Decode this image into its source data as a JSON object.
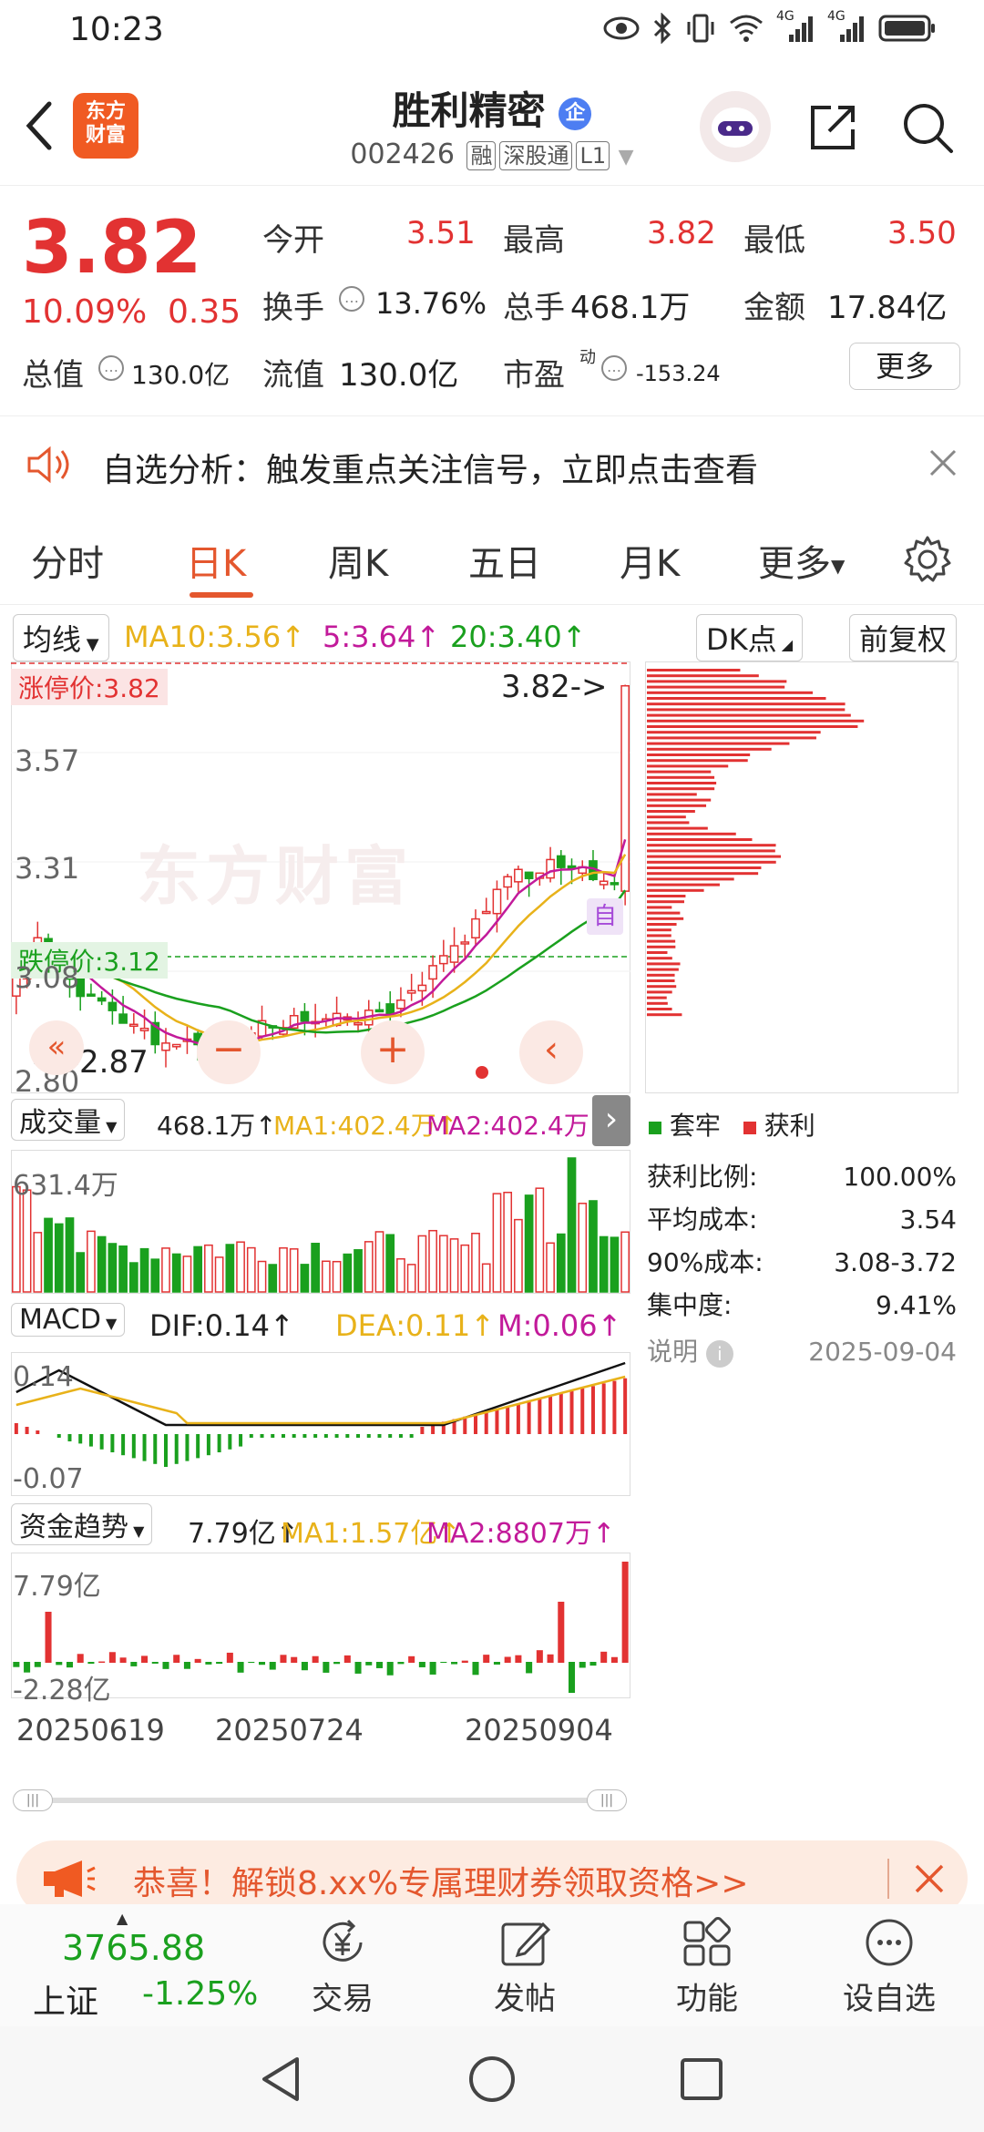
{
  "status": {
    "time": "10:23",
    "net1": "4G",
    "net2": "4G"
  },
  "header": {
    "logo_line1": "东方",
    "logo_line2": "财富",
    "stock_name": "胜利精密",
    "badge": "企",
    "code": "002426",
    "tags": [
      "融",
      "深股通",
      "L1"
    ]
  },
  "quote": {
    "price": "3.82",
    "change_pct": "10.09%",
    "change_amt": "0.35",
    "open_label": "今开",
    "open": "3.51",
    "high_label": "最高",
    "high": "3.82",
    "low_label": "最低",
    "low": "3.50",
    "turnover_label": "换手",
    "turnover": "13.76%",
    "volume_label": "总手",
    "volume": "468.1万",
    "amount_label": "金额",
    "amount": "17.84亿",
    "mktcap_label": "总值",
    "mktcap": "130.0亿",
    "float_label": "流值",
    "float": "130.0亿",
    "pe_label": "市盈",
    "pe_sup": "动",
    "pe": "-153.24",
    "more": "更多"
  },
  "notice": {
    "text": "自选分析：触发重点关注信号，立即点击查看"
  },
  "tabs": [
    {
      "label": "分时",
      "active": false
    },
    {
      "label": "日K",
      "active": true
    },
    {
      "label": "周K",
      "active": false
    },
    {
      "label": "五日",
      "active": false
    },
    {
      "label": "月K",
      "active": false
    },
    {
      "label": "更多",
      "active": false
    }
  ],
  "kline": {
    "indicator": "均线",
    "ma10": "MA10:3.56↑",
    "ma5": "5:3.64↑",
    "ma20": "20:3.40↑",
    "dk_button": "DK点",
    "adjust_button": "前复权",
    "limit_up": "涨停价:3.82",
    "limit_down": "跌停价:3.12",
    "y_3_57": "3.57",
    "y_3_31": "3.31",
    "y_3_08": "3.08",
    "y_2_80": "2.80",
    "current": "3.82->",
    "low_mark": "<--2.87",
    "self_mark": "自",
    "watermark": "东方财富"
  },
  "chips": {
    "legend_trapped": "套牢",
    "legend_profit": "获利",
    "rows": [
      {
        "label": "获利比例:",
        "value": "100.00%"
      },
      {
        "label": "平均成本:",
        "value": "3.54"
      },
      {
        "label": "90%成本:",
        "value": "3.08-3.72"
      },
      {
        "label": "集中度:",
        "value": "9.41%"
      }
    ],
    "note": "说明",
    "date": "2025-09-04"
  },
  "volume": {
    "title": "成交量",
    "value": "468.1万↑",
    "ma1": "MA1:402.4万↑",
    "ma2": "MA2:402.4万↑",
    "ymax": "631.4万"
  },
  "macd": {
    "title": "MACD",
    "dif": "DIF:0.14↑",
    "dea": "DEA:0.11↑",
    "m": "M:0.06↑",
    "ytop": "0.14",
    "ybot": "-0.07"
  },
  "fund": {
    "title": "资金趋势",
    "value": "7.79亿↑",
    "ma1": "MA1:1.57亿↑",
    "ma2": "MA2:8807万↑",
    "ytop": "7.79亿",
    "ybot": "-2.28亿"
  },
  "dates": [
    "20250619",
    "20250724",
    "20250904"
  ],
  "promo": {
    "text": "恭喜！解锁8.xx%专属理财券领取资格>>"
  },
  "bottom": {
    "index_value": "3765.88",
    "index_name": "上证",
    "index_change": "-1.25%",
    "nav": [
      {
        "label": "交易"
      },
      {
        "label": "发帖"
      },
      {
        "label": "功能"
      },
      {
        "label": "设自选"
      }
    ]
  },
  "colors": {
    "red": "#e23232",
    "green": "#1aa01e",
    "orange": "#e4572e",
    "ma10": "#e8b21a",
    "ma20": "#1aa01e",
    "ma5": "#c21a9a"
  }
}
